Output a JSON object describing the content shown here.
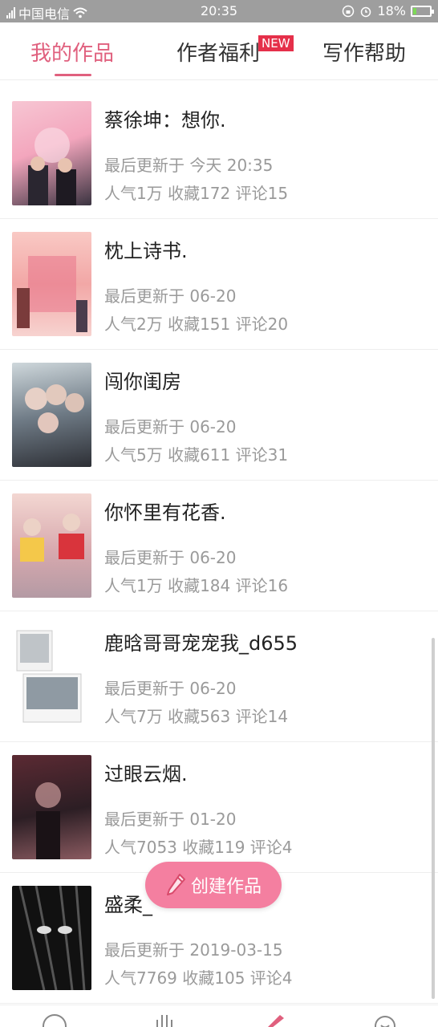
{
  "status_bar": {
    "carrier": "中国电信",
    "time": "20:35",
    "battery": "18%",
    "battery_level": 0.18
  },
  "tabs": [
    {
      "label": "我的作品",
      "active": true
    },
    {
      "label": "作者福利",
      "active": false,
      "badge": "NEW"
    },
    {
      "label": "写作帮助",
      "active": false
    }
  ],
  "works": [
    {
      "title": "蔡徐坤：想你.",
      "updated": "最后更新于 今天 20:35",
      "stats": "人气1万 收藏172 评论15"
    },
    {
      "title": "枕上诗书.",
      "updated": "最后更新于 06-20",
      "stats": "人气2万 收藏151 评论20"
    },
    {
      "title": "闯你闺房",
      "updated": "最后更新于 06-20",
      "stats": "人气5万 收藏611 评论31"
    },
    {
      "title": "你怀里有花香.",
      "updated": "最后更新于 06-20",
      "stats": "人气1万 收藏184 评论16"
    },
    {
      "title": "鹿晗哥哥宠宠我_d655",
      "updated": "最后更新于 06-20",
      "stats": "人气7万 收藏563 评论14"
    },
    {
      "title": "过眼云烟.",
      "updated": "最后更新于 01-20",
      "stats": "人气7053 收藏119 评论4"
    },
    {
      "title": "盛柔_",
      "updated": "最后更新于 2019-03-15",
      "stats": "人气7769 收藏105 评论4"
    }
  ],
  "fab": {
    "label": "创建作品",
    "icon": "pencil-icon"
  },
  "colors": {
    "accent": "#e0607e",
    "fab": "#f47fa0",
    "badge": "#e5304a"
  }
}
